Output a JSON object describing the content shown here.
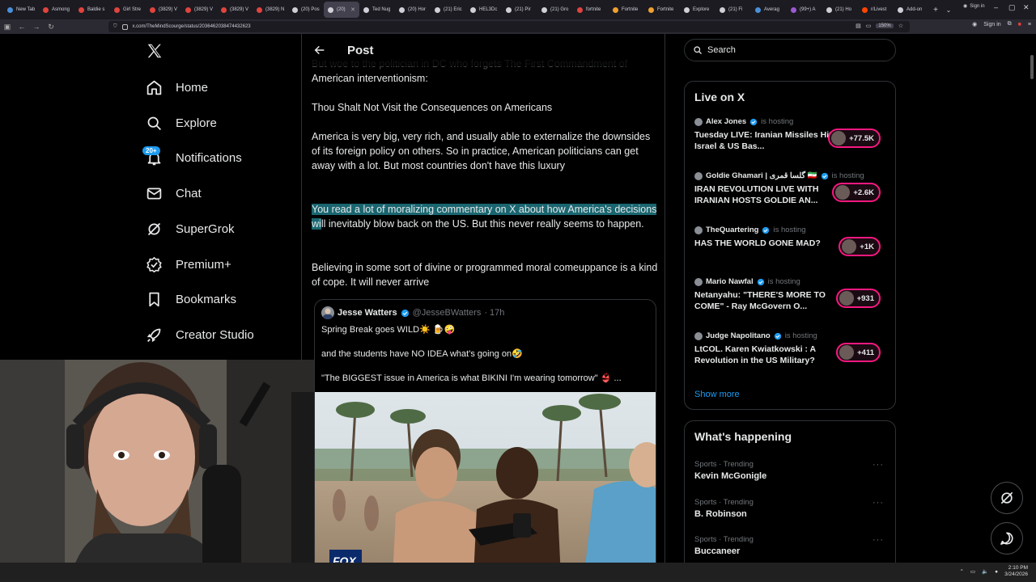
{
  "browser": {
    "tabs": [
      {
        "label": "New Tab",
        "color": "#4a90d9"
      },
      {
        "label": "Asmong",
        "color": "#e0443e"
      },
      {
        "label": "Baldie s",
        "color": "#e0443e"
      },
      {
        "label": "Girl Stre",
        "color": "#e0443e"
      },
      {
        "label": "(3829) V",
        "color": "#e0443e"
      },
      {
        "label": "(3829) V",
        "color": "#e0443e"
      },
      {
        "label": "(3829) V",
        "color": "#e0443e"
      },
      {
        "label": "(3829) N",
        "color": "#e0443e"
      },
      {
        "label": "(20) Pos",
        "color": "#cfcfd8"
      },
      {
        "label": "(20)",
        "color": "#cfcfd8",
        "active": true
      },
      {
        "label": "Ted Nug",
        "color": "#cfcfd8"
      },
      {
        "label": "(20) Hor",
        "color": "#cfcfd8"
      },
      {
        "label": "(21) Eric",
        "color": "#cfcfd8"
      },
      {
        "label": "HEL3Dc",
        "color": "#cfcfd8"
      },
      {
        "label": "(21) Pir",
        "color": "#cfcfd8"
      },
      {
        "label": "(21) Gro",
        "color": "#cfcfd8"
      },
      {
        "label": "fortnite",
        "color": "#e0443e"
      },
      {
        "label": "Fortnite",
        "color": "#f0a030"
      },
      {
        "label": "Fortnite",
        "color": "#f0a030"
      },
      {
        "label": "Explore",
        "color": "#cfcfd8"
      },
      {
        "label": "(21) Fi",
        "color": "#cfcfd8"
      },
      {
        "label": "Averag",
        "color": "#4a90d9"
      },
      {
        "label": "(99+) A",
        "color": "#9b59d0"
      },
      {
        "label": "(21) Ho",
        "color": "#cfcfd8"
      },
      {
        "label": "r/Livest",
        "color": "#ff4500"
      },
      {
        "label": "Add-on",
        "color": "#cfcfd8"
      }
    ],
    "account_label": "Sign in",
    "url": "x.com/TheMindScourge/status/2036462038474432623",
    "zoom": "150%"
  },
  "nav": {
    "items": [
      {
        "label": "Home",
        "icon": "home-icon"
      },
      {
        "label": "Explore",
        "icon": "search-icon"
      },
      {
        "label": "Notifications",
        "icon": "bell-icon"
      },
      {
        "label": "Chat",
        "icon": "mail-icon"
      },
      {
        "label": "SuperGrok",
        "icon": "grok-icon"
      },
      {
        "label": "Premium+",
        "icon": "premium-icon"
      },
      {
        "label": "Bookmarks",
        "icon": "bookmark-icon"
      },
      {
        "label": "Creator Studio",
        "icon": "rocket-icon"
      }
    ],
    "notification_badge": "20+"
  },
  "post": {
    "header_title": "Post",
    "ghost_line": "But woe to the politician in DC who forgets The First Commandment of",
    "paragraphs": {
      "p1": "American interventionism:",
      "p2": "Thou Shalt Not Visit the Consequences on Americans",
      "p3": "America is very big, very rich, and usually able to externalize the downsides of its foreign policy on others. So in practice, American politicians can get away with a lot. But most countries don't have this luxury",
      "p4_highlight": "You read a lot of moralizing commentary on X about how America's decisions wi",
      "p4_rest": "ll inevitably blow back on the US. But this never really seems to happen.",
      "p5": "Believing in some sort of divine or programmed moral comeuppance is a kind of cope. It will never arrive"
    },
    "quote": {
      "name": "Jesse Watters",
      "handle": "@JesseBWatters",
      "time": "· 17h",
      "line1": "Spring Break goes WILD☀️ 🍺🤪",
      "line2": "and the students have NO IDEA what's going on🤣",
      "line3": "\"The BIGGEST issue in America is what BIKINI I'm wearing tomorrow\" 👙 ..."
    }
  },
  "sidebar": {
    "search_placeholder": "Search",
    "live_title": "Live on X",
    "hosting_label": "is hosting",
    "live": [
      {
        "host": "Alex Jones",
        "title": "Tuesday LIVE: Iranian Missiles Hit Israel & US Bas...",
        "listeners": "+77.5K"
      },
      {
        "host": "Goldie Ghamari | گلسا قمری 🇮🇷",
        "title": "IRAN REVOLUTION LIVE WITH IRANIAN HOSTS GOLDIE AN...",
        "listeners": "+2.6K"
      },
      {
        "host": "TheQuartering",
        "title": "HAS THE WORLD GONE MAD?",
        "listeners": "+1K"
      },
      {
        "host": "Mario Nawfal",
        "title": "Netanyahu: \"THERE'S MORE TO COME\" - Ray McGovern O...",
        "listeners": "+931"
      },
      {
        "host": "Judge Napolitano",
        "title": "LtCOL. Karen Kwiatkowski : A Revolution in the US Military?",
        "listeners": "+411"
      }
    ],
    "show_more": "Show more",
    "happening_title": "What's happening",
    "trends": [
      {
        "meta": "Sports · Trending",
        "name": "Kevin McGonigle"
      },
      {
        "meta": "Sports · Trending",
        "name": "B. Robinson"
      },
      {
        "meta": "Sports · Trending",
        "name": "Buccaneer"
      }
    ]
  },
  "taskbar": {
    "time": "2:10 PM",
    "date": "3/24/2026"
  },
  "colors": {
    "accent": "#1d9bf0",
    "live_ring": "#f91880",
    "highlight": "#1a6670"
  }
}
